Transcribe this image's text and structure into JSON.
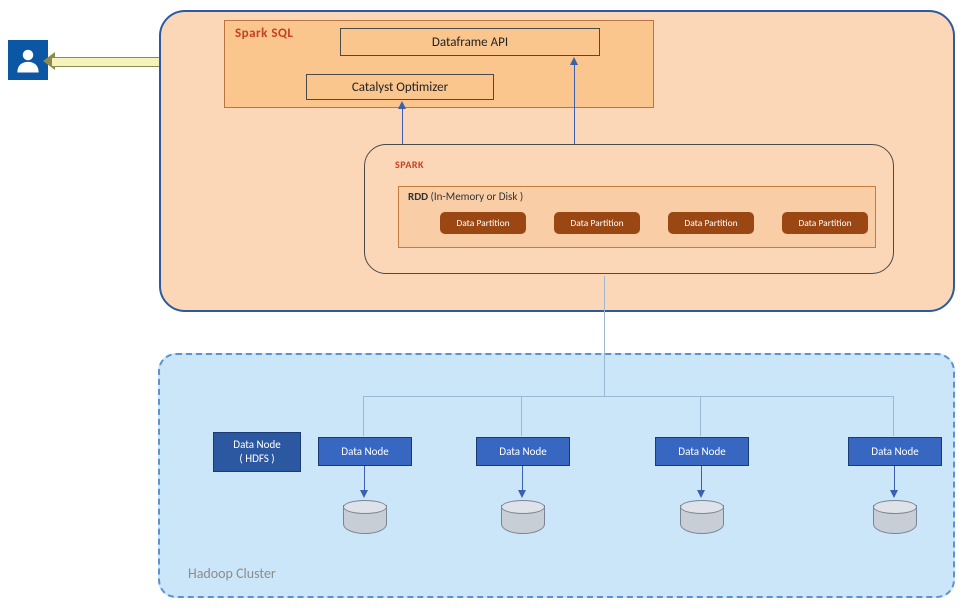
{
  "spark": {
    "sql_section_title": "Spark SQL",
    "dataframe_api_label": "Dataframe API",
    "catalyst_label": "Catalyst Optimizer",
    "inner_title": "SPARK",
    "rdd_label_strong": "RDD",
    "rdd_label_rest": " (In-Memory or Disk )",
    "partitions": [
      "Data Partition",
      "Data Partition",
      "Data Partition",
      "Data Partition"
    ]
  },
  "hadoop": {
    "title": "Hadoop Cluster",
    "name_tag": "Data Node\n( HDFS )",
    "data_nodes": [
      "Data Node",
      "Data Node",
      "Data Node",
      "Data Node"
    ]
  },
  "chart_data": {
    "type": "diagram",
    "title": "Spark SQL over Spark RDD over Hadoop HDFS",
    "actors": [
      "User"
    ],
    "components": [
      {
        "name": "Spark SQL",
        "children": [
          "Dataframe API",
          "Catalyst Optimizer"
        ]
      },
      {
        "name": "SPARK",
        "children": [
          {
            "name": "RDD (In-Memory or Disk)",
            "children": [
              "Data Partition",
              "Data Partition",
              "Data Partition",
              "Data Partition"
            ]
          }
        ]
      },
      {
        "name": "Hadoop Cluster",
        "children": [
          {
            "name": "Data Node (HDFS)",
            "kind": "label"
          },
          {
            "name": "Data Node",
            "storage": "disk"
          },
          {
            "name": "Data Node",
            "storage": "disk"
          },
          {
            "name": "Data Node",
            "storage": "disk"
          },
          {
            "name": "Data Node",
            "storage": "disk"
          }
        ]
      }
    ],
    "edges": [
      {
        "from": "User",
        "to": "Spark SQL",
        "style": "bidirectional"
      },
      {
        "from": "Catalyst Optimizer",
        "to": "RDD",
        "style": "bidirectional vertical"
      },
      {
        "from": "Dataframe API",
        "to": "RDD",
        "style": "bidirectional vertical"
      },
      {
        "from": "SPARK",
        "to": "Hadoop Cluster",
        "style": "vertical"
      },
      {
        "from": "Hadoop Cluster",
        "to": "each Data Node",
        "style": "tree fan-out"
      },
      {
        "from": "Data Node",
        "to": "disk",
        "style": "vertical",
        "count": 4
      }
    ]
  }
}
